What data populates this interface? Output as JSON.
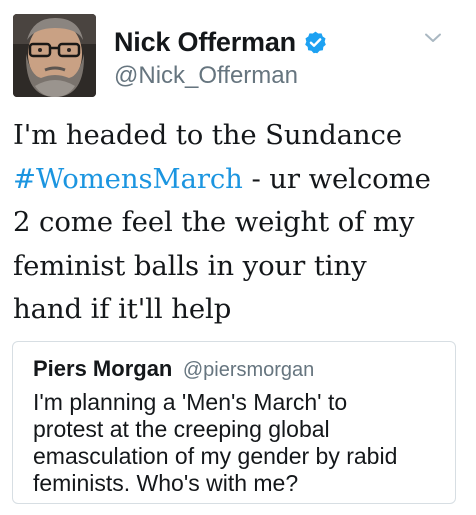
{
  "author": {
    "display_name": "Nick Offerman",
    "handle": "@Nick_Offerman",
    "verified_icon": "verified-badge-icon",
    "avatar_icon": "bearded-man-avatar"
  },
  "tweet": {
    "lines": [
      {
        "before": "I'm headed to the Sundance",
        "hashtag": "",
        "after": ""
      },
      {
        "before": "",
        "hashtag": "#WomensMarch",
        "after": " - ur welcome"
      },
      {
        "before": "2 come feel the weight of my",
        "hashtag": "",
        "after": ""
      },
      {
        "before": "feminist balls in your tiny",
        "hashtag": "",
        "after": ""
      },
      {
        "before": "hand if it'll help",
        "hashtag": "",
        "after": ""
      }
    ]
  },
  "quoted_tweet": {
    "display_name": "Piers Morgan",
    "handle": "@piersmorgan",
    "lines": [
      "I'm planning a 'Men's March' to",
      "protest at the creeping global",
      "emasculation of my gender by rabid",
      "feminists. Who's with me?"
    ]
  },
  "colors": {
    "link": "#1b95e0",
    "verified": "#1da1f2",
    "secondary_text": "#66757f",
    "border": "#d7dee3"
  },
  "menu_icon": "chevron-down-icon"
}
